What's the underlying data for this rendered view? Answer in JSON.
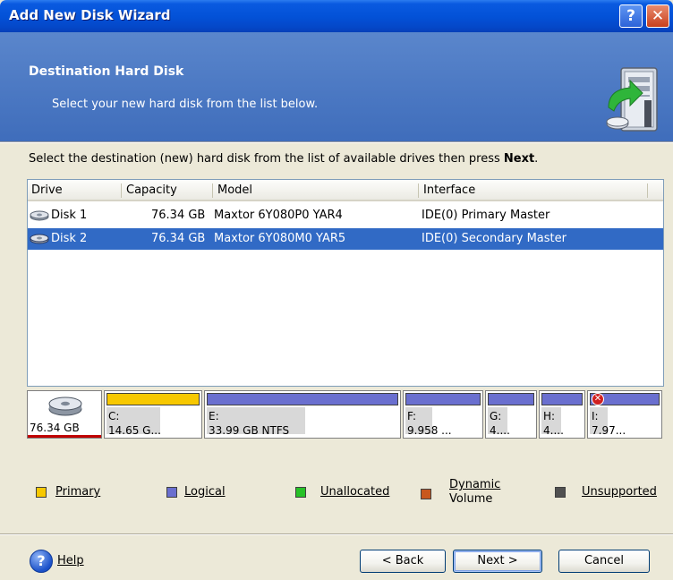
{
  "window": {
    "title": "Add New Disk Wizard",
    "help_glyph": "?",
    "close_glyph": "✕"
  },
  "header": {
    "title": "Destination Hard Disk",
    "subtitle": "Select your new hard disk from the list below.",
    "graphic_icon": "computer-with-disk-arrow-icon"
  },
  "instruction": {
    "text": "Select the destination (new) hard disk from the list of available drives then press ",
    "emphasis": "Next",
    "suffix": "."
  },
  "drive_list": {
    "columns": [
      "Drive",
      "Capacity",
      "Model",
      "Interface"
    ],
    "rows": [
      {
        "drive": "Disk 1",
        "capacity": "76.34 GB",
        "model": "Maxtor 6Y080P0 YAR4",
        "interface": "IDE(0) Primary Master",
        "selected": false
      },
      {
        "drive": "Disk 2",
        "capacity": "76.34 GB",
        "model": "Maxtor 6Y080M0 YAR5",
        "interface": "IDE(0) Secondary Master",
        "selected": true
      }
    ]
  },
  "disk_map": {
    "disk_size": "76.34 GB",
    "partitions": [
      {
        "letter": "C:",
        "info": "14.65 G...",
        "type": "primary"
      },
      {
        "letter": "E:",
        "info": "33.99 GB  NTFS",
        "type": "logical"
      },
      {
        "letter": "F:",
        "info": "9.958 ...",
        "type": "logical"
      },
      {
        "letter": "G:",
        "info": "4....",
        "type": "logical"
      },
      {
        "letter": "H:",
        "info": "4....",
        "type": "logical"
      },
      {
        "letter": "I:",
        "info": "7.97...",
        "type": "logical",
        "error_badge": "✕"
      }
    ]
  },
  "legend": [
    {
      "label": "Primary",
      "color": "#f7c800"
    },
    {
      "label": "Logical",
      "color": "#6a6fcf"
    },
    {
      "label": "Unallocated",
      "color": "#27c127"
    },
    {
      "label_line1": "Dynamic",
      "label_line2": "Volume",
      "color": "#c8581e"
    },
    {
      "label": "Unsupported",
      "color": "#505050"
    }
  ],
  "footer": {
    "help_glyph": "?",
    "help_label": "Help",
    "back_label": "< Back",
    "next_label": "Next >",
    "cancel_label": "Cancel"
  }
}
